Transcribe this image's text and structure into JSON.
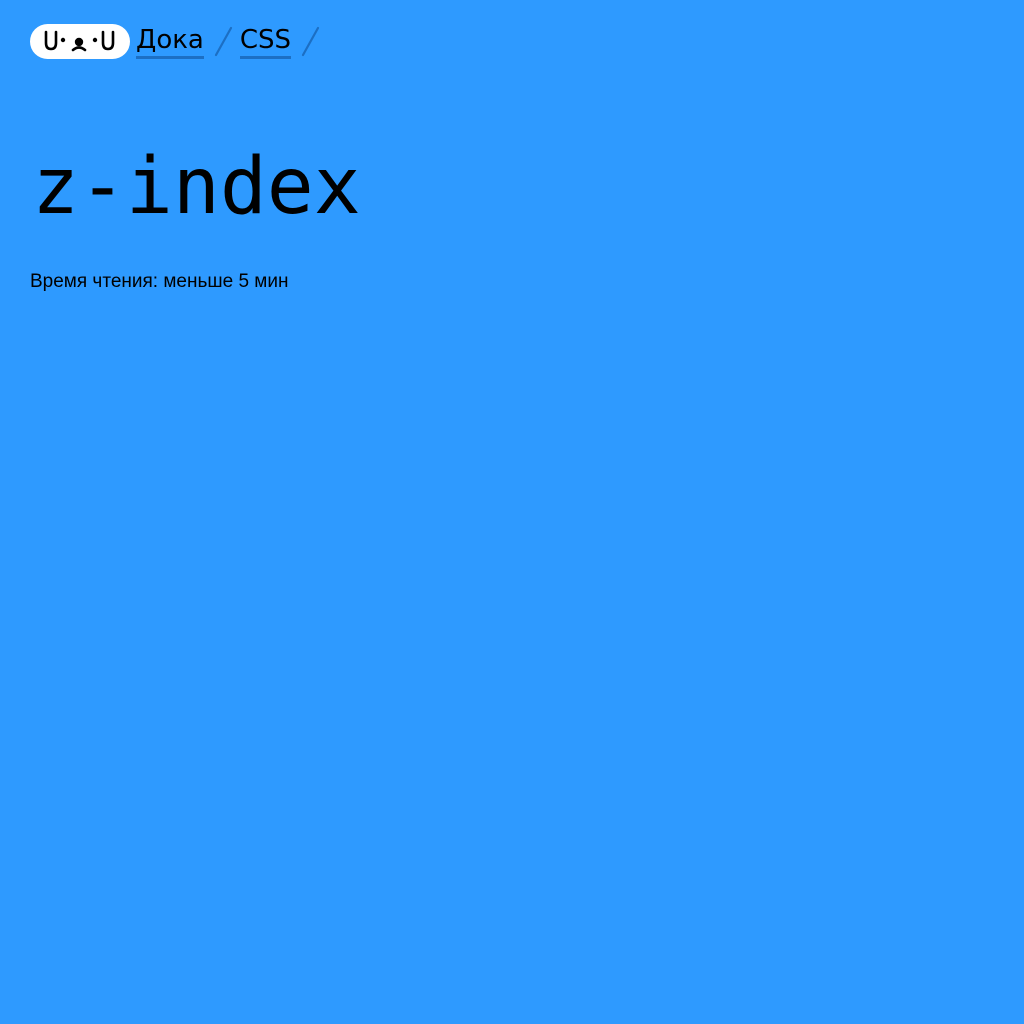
{
  "header": {
    "logo_alt": "U•ᴥ•U",
    "breadcrumbs": [
      {
        "label": "Дока"
      },
      {
        "label": "CSS"
      }
    ]
  },
  "page": {
    "title": "z-index",
    "reading_time": "Время чтения: меньше 5 мин"
  },
  "colors": {
    "background": "#2e9aff",
    "text": "#000000",
    "logo_bg": "#ffffff",
    "breadcrumb_underline": "#1c6fc4"
  }
}
